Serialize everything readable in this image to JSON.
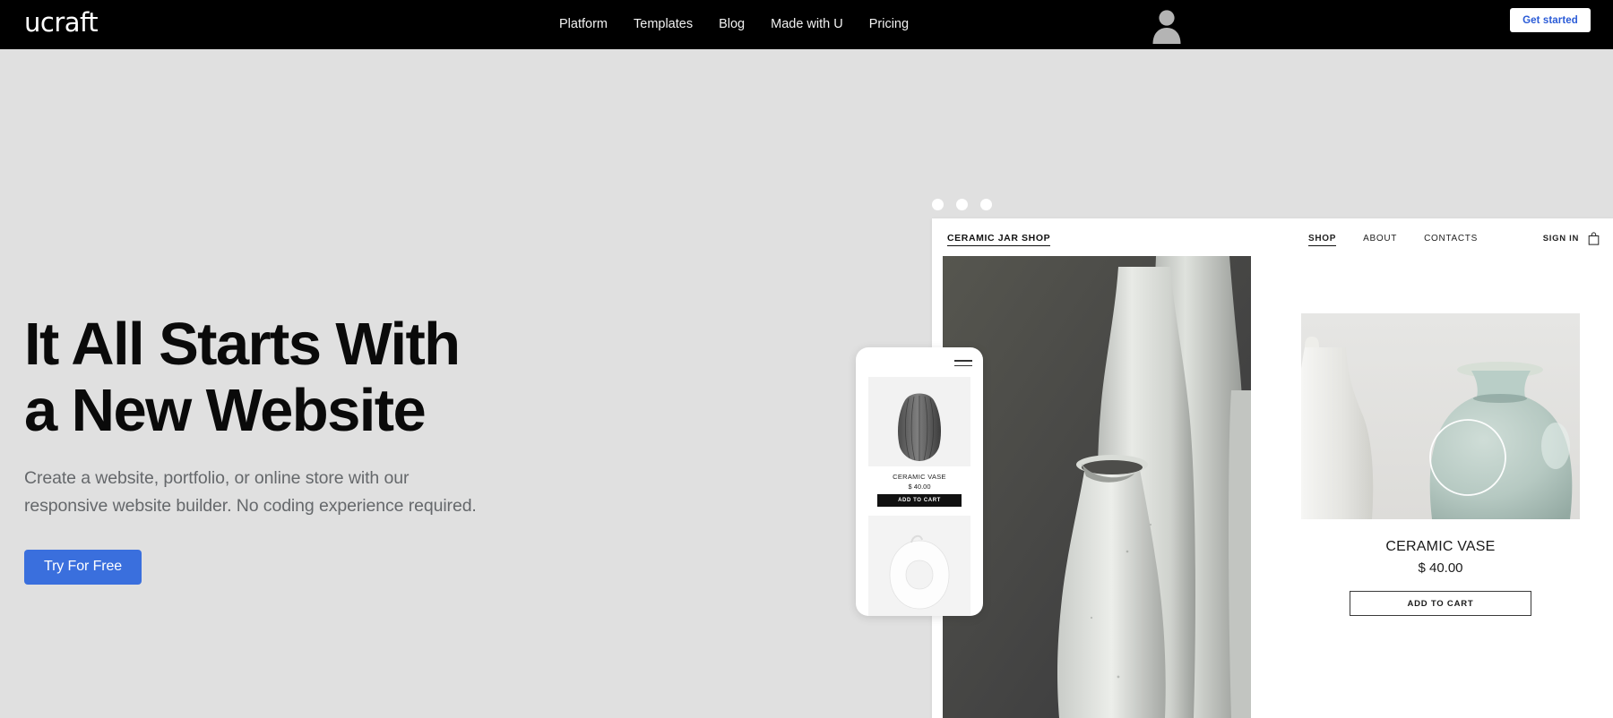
{
  "topnav": {
    "logo": "ucraft",
    "menu": [
      {
        "label": "Platform"
      },
      {
        "label": "Templates"
      },
      {
        "label": "Blog"
      },
      {
        "label": "Made with U"
      },
      {
        "label": "Pricing"
      }
    ],
    "avatar_icon": "user-avatar-icon",
    "cta_label": "Get started",
    "background_color": "#000000",
    "cta_text_color": "#2a5bd7"
  },
  "hero": {
    "title_line1": "It All Starts With",
    "title_line2": "a New Website",
    "subtitle_line1": "Create a website, portfolio, or online store with our",
    "subtitle_line2": "responsive website builder. No coding experience required.",
    "cta_label": "Try For Free",
    "cta_color": "#3a6fdd",
    "background_color": "#e0e0e0",
    "title_color": "#0a0a0a",
    "subtitle_color": "#65686b"
  },
  "browser_mockup": {
    "window_dots": [
      "dot-1",
      "dot-2",
      "dot-3"
    ],
    "shop": {
      "brand": "CERAMIC JAR SHOP",
      "links": [
        {
          "label": "SHOP",
          "active": true
        },
        {
          "label": "ABOUT",
          "active": false
        },
        {
          "label": "CONTACTS",
          "active": false
        }
      ],
      "signin_label": "SIGN IN",
      "cart_icon": "shopping-bag-icon"
    }
  },
  "phone_mockup": {
    "menu_icon": "hamburger-menu-icon",
    "product": {
      "name": "CERAMIC VASE",
      "price": "$ 40.00",
      "button_label": "ADD TO CART"
    }
  },
  "product_card": {
    "name": "CERAMIC VASE",
    "price": "$ 40.00",
    "button_label": "ADD TO CART"
  }
}
